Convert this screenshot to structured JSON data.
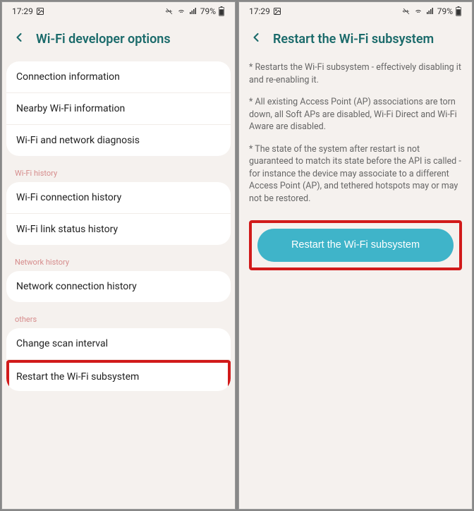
{
  "status": {
    "time": "17:29",
    "battery_pct": "79%"
  },
  "left": {
    "title": "Wi-Fi developer options",
    "group1": [
      "Connection information",
      "Nearby Wi-Fi information",
      "Wi-Fi and network diagnosis"
    ],
    "section_wifi_history": "Wi-Fi history",
    "group2": [
      "Wi-Fi connection history",
      "Wi-Fi link status history"
    ],
    "section_network_history": "Network history",
    "group3": [
      "Network connection history"
    ],
    "section_others": "others",
    "group4": [
      "Change scan interval",
      "Restart the Wi-Fi subsystem"
    ]
  },
  "right": {
    "title": "Restart the Wi-Fi subsystem",
    "para1": "* Restarts the Wi-Fi subsystem - effectively disabling it and re-enabling it.",
    "para2": "* All existing Access Point (AP) associations are torn down, all Soft APs are disabled, Wi-Fi Direct and Wi-Fi Aware are disabled.",
    "para3": "* The state of the system after restart is not guaranteed to match its state before the API is called - for instance the device may associate to a different Access Point (AP), and tethered hotspots may or may not be restored.",
    "button": "Restart the Wi-Fi subsystem"
  }
}
